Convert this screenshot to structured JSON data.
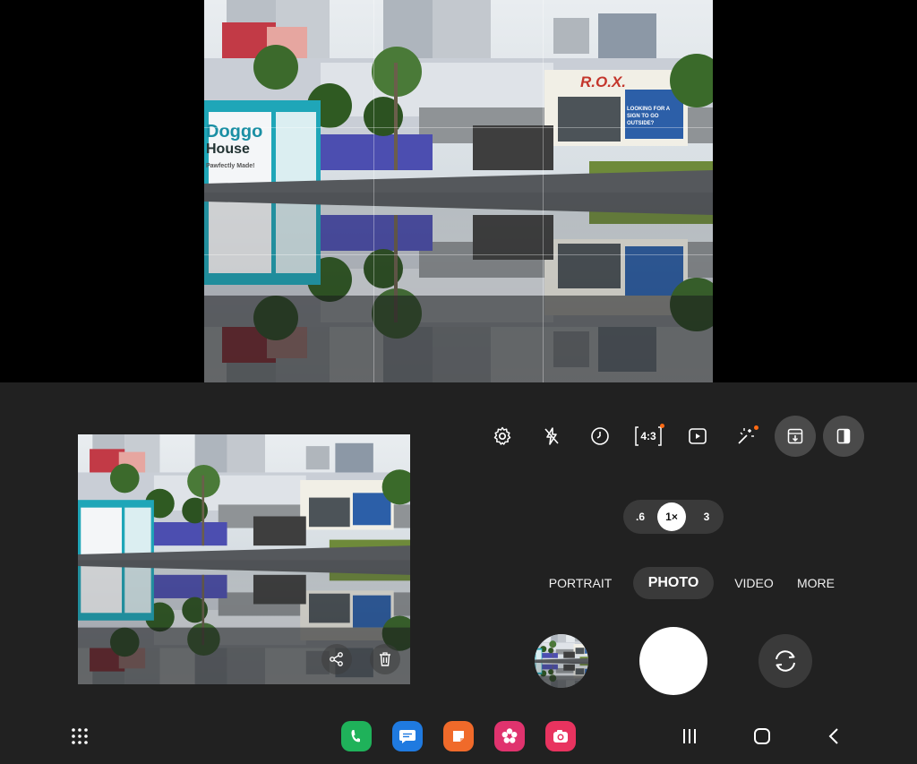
{
  "viewfinder": {
    "signs": {
      "store_left_line1": "Doggo",
      "store_left_line2": "House",
      "store_left_tagline": "Pawfectly Made!",
      "store_right": "R.O.X.",
      "store_right_banner": "LOOKING FOR A SIGN TO GO OUTSIDE?"
    }
  },
  "toolbar": {
    "aspect_ratio": "4:3",
    "icons": [
      "gear-icon",
      "flash-off-icon",
      "timer-icon",
      "aspect-ratio-icon",
      "motion-photo-icon",
      "filter-effects-icon",
      "download-icon",
      "split-view-icon"
    ]
  },
  "zoom": {
    "options": [
      ".6",
      "1×",
      "3"
    ],
    "selected": "1×"
  },
  "modes": {
    "items": [
      "PORTRAIT",
      "PHOTO",
      "VIDEO",
      "MORE"
    ],
    "selected": "PHOTO"
  },
  "preview": {
    "buttons": [
      "share-icon",
      "trash-icon"
    ]
  },
  "taskbar": {
    "apps": [
      {
        "name": "phone",
        "color": "#1fb25a"
      },
      {
        "name": "messages",
        "color": "#1f7ae0"
      },
      {
        "name": "notes",
        "color": "#f06a2a"
      },
      {
        "name": "gallery",
        "color": "#e0336e"
      },
      {
        "name": "camera",
        "color": "#e8335f"
      }
    ]
  },
  "colors": {
    "panel": "#212121",
    "badge": "#ff6a13",
    "accent_shutter": "#ffffff"
  }
}
